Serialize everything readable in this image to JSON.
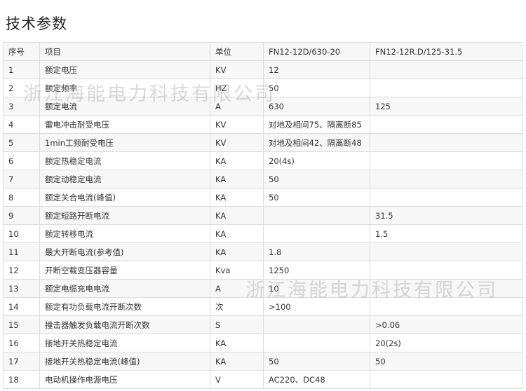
{
  "title": "技术参数",
  "watermark": "浙江海能电力科技有限公司",
  "table": {
    "headers": [
      "序号",
      "项目",
      "单位",
      "FN12-12D/630-20",
      "FN12-12R.D/125-31.5"
    ],
    "rows": [
      [
        "1",
        "额定电压",
        "KV",
        "12",
        ""
      ],
      [
        "2",
        "额定频率",
        "HZ",
        "50",
        ""
      ],
      [
        "3",
        "额定电流",
        "A",
        "630",
        "125"
      ],
      [
        "4",
        "雷电冲击耐受电压",
        "KV",
        "对地及相间75、隔离断85",
        ""
      ],
      [
        "5",
        "1min工频耐受电压",
        "KV",
        "对地及相间42、隔离断48",
        ""
      ],
      [
        "6",
        "额定热稳定电流",
        "KA",
        "20(4s)",
        ""
      ],
      [
        "7",
        "额定动稳定电流",
        "KA",
        "50",
        ""
      ],
      [
        "8",
        "额定关合电流(峰值)",
        "KA",
        "50",
        ""
      ],
      [
        "9",
        "额定短路开断电流",
        "KA",
        "",
        "31.5"
      ],
      [
        "10",
        "额定转移电流",
        "KA",
        "",
        "1.5"
      ],
      [
        "11",
        "最大开断电流(参考值)",
        "KA",
        "1.8",
        ""
      ],
      [
        "12",
        "开断空载变压器容量",
        "Kva",
        "1250",
        ""
      ],
      [
        "13",
        "额定电缆充电电流",
        "A",
        "10",
        ""
      ],
      [
        "14",
        "额定有功负载电流开断次数",
        "次",
        ">100",
        ""
      ],
      [
        "15",
        "撞击器触发负载电流开断次数",
        "S",
        "",
        ">0.06"
      ],
      [
        "16",
        "接地开关热稳定电流",
        "KA",
        "",
        "20(2s)"
      ],
      [
        "17",
        "接地开关热稳定电流(峰值)",
        "KA",
        "50",
        "50"
      ],
      [
        "18",
        "电动机操作电源电压",
        "V",
        "AC220、DC48",
        ""
      ]
    ]
  }
}
